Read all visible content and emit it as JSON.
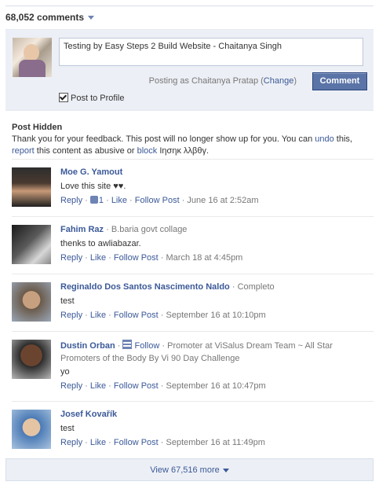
{
  "header": {
    "comment_count": "68,052 comments"
  },
  "composer": {
    "input_value": "Testing by Easy Steps 2 Build Website - Chaitanya Singh",
    "posting_as_prefix": "Posting as Chaitanya Pratap (",
    "change_label": "Change",
    "posting_as_suffix": ")",
    "comment_button": "Comment",
    "post_to_profile": "Post to Profile",
    "post_to_profile_checked": true
  },
  "hidden_notice": {
    "title": "Post Hidden",
    "line1": "Thank you for your feedback. This post will no longer show up for you. You can ",
    "undo": "undo",
    "line1_end": " this,",
    "report": "report",
    "line2_mid": " this content as abusive or ",
    "block": "block",
    "block_name": "Ιησηκ λλβθγ."
  },
  "comments": [
    {
      "name": "Moe G. Yamout",
      "extra": "",
      "text": "Love this site ♥♥.",
      "reply": "Reply",
      "likes": "1",
      "like": "Like",
      "follow": "Follow Post",
      "time": "June 16 at 2:52am"
    },
    {
      "name": "Fahim Raz",
      "extra": "B.baria govt collage",
      "text": "thenks to awliabazar.",
      "reply": "Reply",
      "likes": "",
      "like": "Like",
      "follow": "Follow Post",
      "time": "March 18 at 4:45pm"
    },
    {
      "name": "Reginaldo Dos Santos Nascimento Naldo",
      "extra": "Completo",
      "text": "test",
      "reply": "Reply",
      "likes": "",
      "like": "Like",
      "follow": "Follow Post",
      "time": "September 16 at 10:10pm"
    },
    {
      "name": "Dustin Orban",
      "extra": "Follow",
      "extra2": "Promoter at ViSalus Dream Team ~ All Star Promoters of the Body By Vi 90 Day Challenge",
      "text": "yo",
      "reply": "Reply",
      "likes": "",
      "like": "Like",
      "follow": "Follow Post",
      "time": "September 16 at 10:47pm"
    },
    {
      "name": "Josef Kovařík",
      "extra": "",
      "text": "test",
      "reply": "Reply",
      "likes": "",
      "like": "Like",
      "follow": "Follow Post",
      "time": "September 16 at 11:49pm"
    }
  ],
  "footer": {
    "view_more": "View 67,516 more"
  },
  "colors": {
    "link": "#3b5998",
    "button": "#5b74a8",
    "panel": "#eceff5"
  }
}
